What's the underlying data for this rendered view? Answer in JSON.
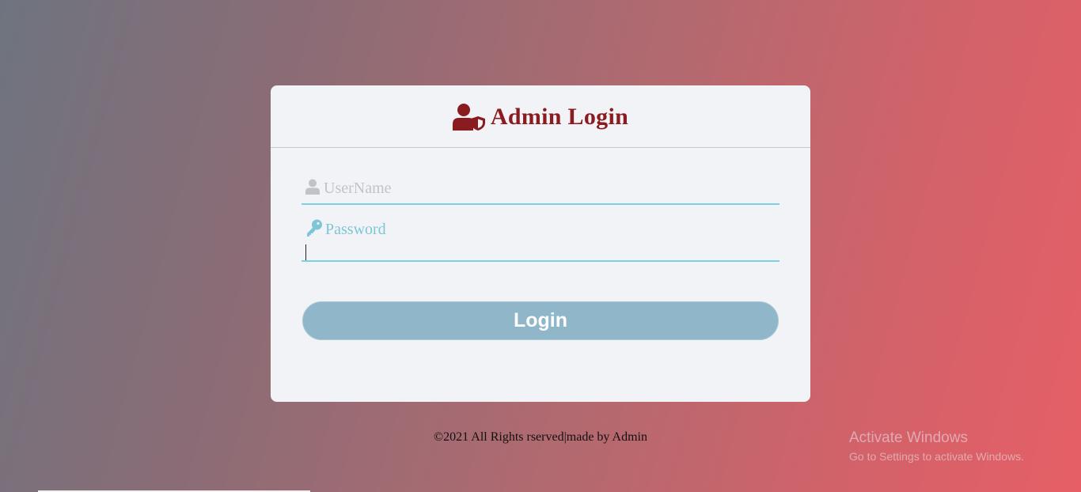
{
  "page": {
    "title": "Admin Login",
    "colors": {
      "title": "#8a1b1f",
      "accent_line": "#7dd0e0",
      "button_bg": "#8fb7c9",
      "card_bg": "#f2f3f7"
    }
  },
  "header": {
    "icon": "user-shield-icon",
    "title": "Admin Login"
  },
  "form": {
    "username": {
      "icon": "user-icon",
      "placeholder": "UserName",
      "value": ""
    },
    "password": {
      "icon": "key-icon",
      "placeholder": "Password",
      "value": ""
    },
    "submit_label": "Login"
  },
  "footer": {
    "text": "©2021 All Rights rserved|made by Admin"
  },
  "watermark": {
    "title": "Activate Windows",
    "subtitle": "Go to Settings to activate Windows."
  }
}
